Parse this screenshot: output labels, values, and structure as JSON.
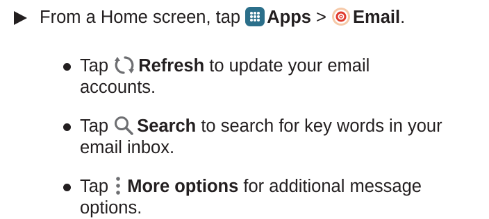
{
  "step": {
    "text_before": "From a Home screen, tap ",
    "apps_label": "Apps",
    "separator": " > ",
    "email_label": "Email",
    "period": "."
  },
  "bullets": [
    {
      "prefix": "Tap ",
      "bold": "Refresh",
      "rest_line1": " to update your email",
      "line2": "accounts.",
      "icon": "refresh-icon"
    },
    {
      "prefix": "Tap ",
      "bold": "Search",
      "rest_line1": " to search for key words in your",
      "line2": "email inbox.",
      "icon": "search-icon"
    },
    {
      "prefix": "Tap ",
      "bold": "More options",
      "rest_line1": " for additional message",
      "line2": "options.",
      "icon": "more-options-icon"
    }
  ],
  "colors": {
    "text": "#231f20",
    "apps_icon_bg": "#2b6f8a",
    "email_icon_red": "#e03b2e",
    "icon_gray": "#6d6e71"
  }
}
